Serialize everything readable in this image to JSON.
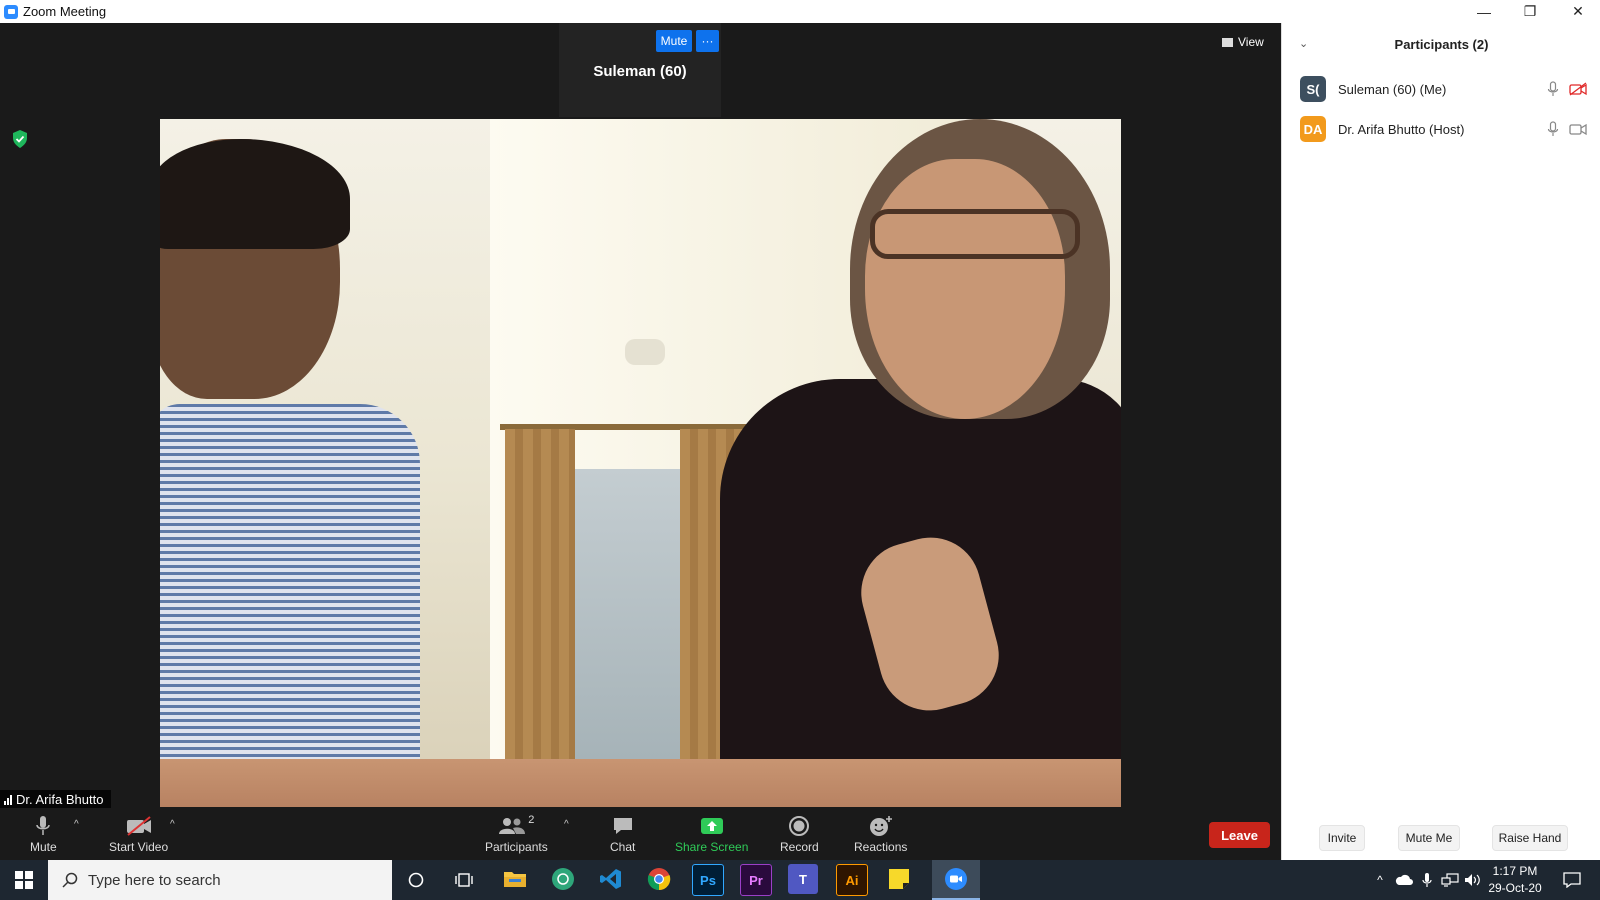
{
  "window": {
    "title": "Zoom Meeting",
    "minimize": "—",
    "restore": "❐",
    "close": "✕"
  },
  "meeting": {
    "active_speaker": {
      "name": "Suleman (60)",
      "mute_label": "Mute",
      "more_label": "···"
    },
    "view_label": "View",
    "video_name_label": "Dr. Arifa Bhutto"
  },
  "toolbar": {
    "mute_label": "Mute",
    "start_video_label": "Start Video",
    "participants_label": "Participants",
    "participants_count": "2",
    "chat_label": "Chat",
    "share_screen_label": "Share Screen",
    "record_label": "Record",
    "reactions_label": "Reactions",
    "leave_label": "Leave"
  },
  "participants_panel": {
    "title": "Participants (2)",
    "participants": [
      {
        "initials": "S(",
        "name": "Suleman (60) (Me)",
        "avatar_color": "#3d4f5f",
        "video_off": true
      },
      {
        "initials": "DA",
        "name": "Dr. Arifa Bhutto (Host)",
        "avatar_color": "#f29a1c",
        "video_off": false
      }
    ],
    "footer": {
      "invite_label": "Invite",
      "mute_me_label": "Mute Me",
      "raise_hand_label": "Raise Hand"
    }
  },
  "taskbar": {
    "search_placeholder": "Type here to search",
    "time": "1:17 PM",
    "date": "29-Oct-20",
    "apps": [
      "file-explorer",
      "chatgpt",
      "vscode",
      "chrome",
      "photoshop",
      "premiere",
      "teams",
      "illustrator",
      "sticky-notes",
      "zoom"
    ],
    "app_labels": {
      "photoshop": "Ps",
      "premiere": "Pr",
      "illustrator": "Ai",
      "teams": "T"
    }
  },
  "colors": {
    "accent_blue": "#0e72ed",
    "leave_red": "#c8251b",
    "share_green": "#2fcb58"
  }
}
